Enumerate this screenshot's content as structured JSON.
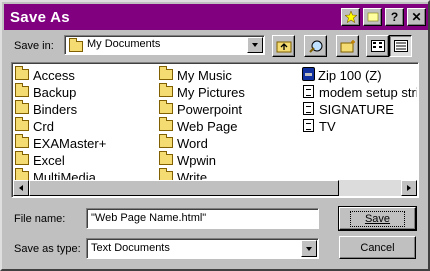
{
  "window": {
    "title": "Save As"
  },
  "toolbar": {
    "save_in_label": "Save in:",
    "save_in_value": "My Documents"
  },
  "files": {
    "col1": [
      "Access",
      "Backup",
      "Binders",
      "Crd",
      "EXAMaster+",
      "Excel",
      "MultiMedia"
    ],
    "col2": [
      "My Music",
      "My Pictures",
      "Powerpoint",
      "Web Page",
      "Word",
      "Wpwin",
      "Write"
    ],
    "col3": [
      {
        "name": "Zip 100 (Z)",
        "icon": "zip-drive-icon"
      },
      {
        "name": "modem setup stri",
        "icon": "document-icon"
      },
      {
        "name": "SIGNATURE",
        "icon": "document-icon"
      },
      {
        "name": "TV",
        "icon": "document-icon"
      }
    ]
  },
  "form": {
    "file_name_label": "File name:",
    "file_name_value": "\"Web Page Name.html\"",
    "save_as_type_label": "Save as type:",
    "save_as_type_value": "Text Documents"
  },
  "buttons": {
    "save": "Save",
    "cancel": "Cancel"
  },
  "colors": {
    "titlebar": "#800080",
    "face": "#c0c0c0"
  }
}
